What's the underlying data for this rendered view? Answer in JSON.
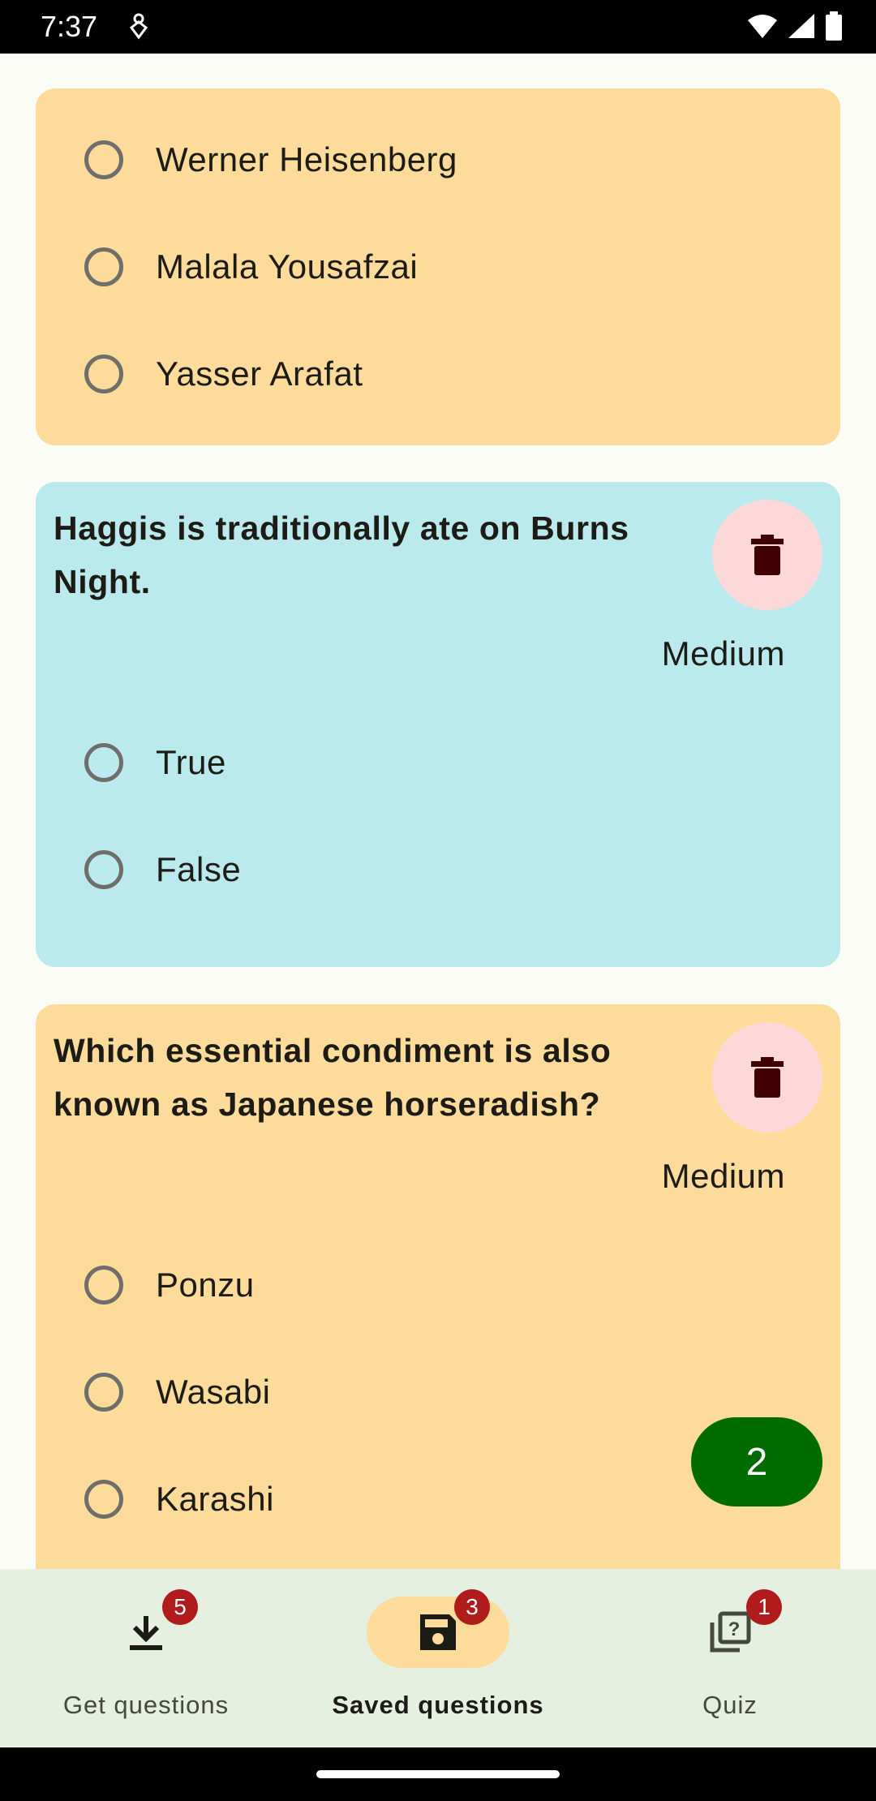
{
  "status_bar": {
    "time": "7:37",
    "icons": [
      "notification-icon",
      "wifi-icon",
      "signal-icon",
      "battery-icon"
    ]
  },
  "cards": [
    {
      "color": "#FDDC9B",
      "question": "",
      "options": [
        "Werner Heisenberg",
        "Malala Yousafzai",
        "Yasser Arafat"
      ]
    },
    {
      "color": "#BAEAEE",
      "question": "Haggis is traditionally ate on Burns Night.",
      "difficulty": "Medium",
      "options": [
        "True",
        "False"
      ]
    },
    {
      "color": "#FDDC9B",
      "question": "Which essential condiment is also known as Japanese horseradish?",
      "difficulty": "Medium",
      "options": [
        "Ponzu",
        "Wasabi",
        "Karashi"
      ]
    }
  ],
  "fab": {
    "label": "2"
  },
  "bottom_nav": {
    "items": [
      {
        "label": "Get questions",
        "badge": "5",
        "icon": "download-icon",
        "active": false
      },
      {
        "label": "Saved questions",
        "badge": "3",
        "icon": "save-icon",
        "active": true
      },
      {
        "label": "Quiz",
        "badge": "1",
        "icon": "quiz-icon",
        "active": false
      }
    ]
  },
  "colors": {
    "accent": "#006C00",
    "badge": "#B01C1C",
    "delete_bg": "#FCD9D8",
    "delete_icon": "#410002"
  }
}
